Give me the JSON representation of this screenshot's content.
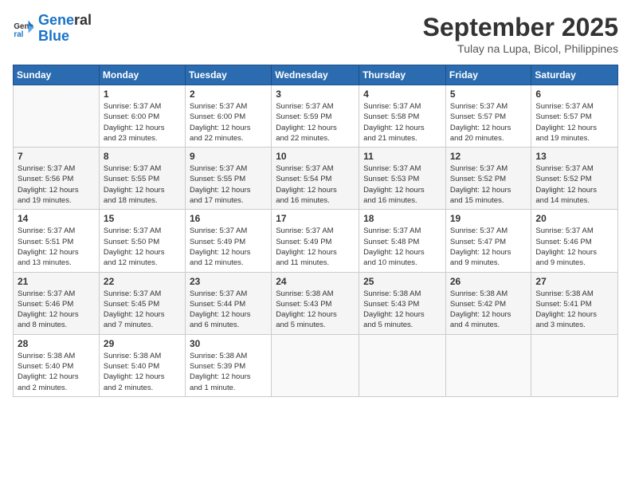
{
  "logo": {
    "line1": "General",
    "line2": "Blue"
  },
  "title": "September 2025",
  "location": "Tulay na Lupa, Bicol, Philippines",
  "days_header": [
    "Sunday",
    "Monday",
    "Tuesday",
    "Wednesday",
    "Thursday",
    "Friday",
    "Saturday"
  ],
  "weeks": [
    [
      {
        "day": "",
        "info": ""
      },
      {
        "day": "1",
        "info": "Sunrise: 5:37 AM\nSunset: 6:00 PM\nDaylight: 12 hours\nand 23 minutes."
      },
      {
        "day": "2",
        "info": "Sunrise: 5:37 AM\nSunset: 6:00 PM\nDaylight: 12 hours\nand 22 minutes."
      },
      {
        "day": "3",
        "info": "Sunrise: 5:37 AM\nSunset: 5:59 PM\nDaylight: 12 hours\nand 22 minutes."
      },
      {
        "day": "4",
        "info": "Sunrise: 5:37 AM\nSunset: 5:58 PM\nDaylight: 12 hours\nand 21 minutes."
      },
      {
        "day": "5",
        "info": "Sunrise: 5:37 AM\nSunset: 5:57 PM\nDaylight: 12 hours\nand 20 minutes."
      },
      {
        "day": "6",
        "info": "Sunrise: 5:37 AM\nSunset: 5:57 PM\nDaylight: 12 hours\nand 19 minutes."
      }
    ],
    [
      {
        "day": "7",
        "info": "Sunrise: 5:37 AM\nSunset: 5:56 PM\nDaylight: 12 hours\nand 19 minutes."
      },
      {
        "day": "8",
        "info": "Sunrise: 5:37 AM\nSunset: 5:55 PM\nDaylight: 12 hours\nand 18 minutes."
      },
      {
        "day": "9",
        "info": "Sunrise: 5:37 AM\nSunset: 5:55 PM\nDaylight: 12 hours\nand 17 minutes."
      },
      {
        "day": "10",
        "info": "Sunrise: 5:37 AM\nSunset: 5:54 PM\nDaylight: 12 hours\nand 16 minutes."
      },
      {
        "day": "11",
        "info": "Sunrise: 5:37 AM\nSunset: 5:53 PM\nDaylight: 12 hours\nand 16 minutes."
      },
      {
        "day": "12",
        "info": "Sunrise: 5:37 AM\nSunset: 5:52 PM\nDaylight: 12 hours\nand 15 minutes."
      },
      {
        "day": "13",
        "info": "Sunrise: 5:37 AM\nSunset: 5:52 PM\nDaylight: 12 hours\nand 14 minutes."
      }
    ],
    [
      {
        "day": "14",
        "info": "Sunrise: 5:37 AM\nSunset: 5:51 PM\nDaylight: 12 hours\nand 13 minutes."
      },
      {
        "day": "15",
        "info": "Sunrise: 5:37 AM\nSunset: 5:50 PM\nDaylight: 12 hours\nand 12 minutes."
      },
      {
        "day": "16",
        "info": "Sunrise: 5:37 AM\nSunset: 5:49 PM\nDaylight: 12 hours\nand 12 minutes."
      },
      {
        "day": "17",
        "info": "Sunrise: 5:37 AM\nSunset: 5:49 PM\nDaylight: 12 hours\nand 11 minutes."
      },
      {
        "day": "18",
        "info": "Sunrise: 5:37 AM\nSunset: 5:48 PM\nDaylight: 12 hours\nand 10 minutes."
      },
      {
        "day": "19",
        "info": "Sunrise: 5:37 AM\nSunset: 5:47 PM\nDaylight: 12 hours\nand 9 minutes."
      },
      {
        "day": "20",
        "info": "Sunrise: 5:37 AM\nSunset: 5:46 PM\nDaylight: 12 hours\nand 9 minutes."
      }
    ],
    [
      {
        "day": "21",
        "info": "Sunrise: 5:37 AM\nSunset: 5:46 PM\nDaylight: 12 hours\nand 8 minutes."
      },
      {
        "day": "22",
        "info": "Sunrise: 5:37 AM\nSunset: 5:45 PM\nDaylight: 12 hours\nand 7 minutes."
      },
      {
        "day": "23",
        "info": "Sunrise: 5:37 AM\nSunset: 5:44 PM\nDaylight: 12 hours\nand 6 minutes."
      },
      {
        "day": "24",
        "info": "Sunrise: 5:38 AM\nSunset: 5:43 PM\nDaylight: 12 hours\nand 5 minutes."
      },
      {
        "day": "25",
        "info": "Sunrise: 5:38 AM\nSunset: 5:43 PM\nDaylight: 12 hours\nand 5 minutes."
      },
      {
        "day": "26",
        "info": "Sunrise: 5:38 AM\nSunset: 5:42 PM\nDaylight: 12 hours\nand 4 minutes."
      },
      {
        "day": "27",
        "info": "Sunrise: 5:38 AM\nSunset: 5:41 PM\nDaylight: 12 hours\nand 3 minutes."
      }
    ],
    [
      {
        "day": "28",
        "info": "Sunrise: 5:38 AM\nSunset: 5:40 PM\nDaylight: 12 hours\nand 2 minutes."
      },
      {
        "day": "29",
        "info": "Sunrise: 5:38 AM\nSunset: 5:40 PM\nDaylight: 12 hours\nand 2 minutes."
      },
      {
        "day": "30",
        "info": "Sunrise: 5:38 AM\nSunset: 5:39 PM\nDaylight: 12 hours\nand 1 minute."
      },
      {
        "day": "",
        "info": ""
      },
      {
        "day": "",
        "info": ""
      },
      {
        "day": "",
        "info": ""
      },
      {
        "day": "",
        "info": ""
      }
    ]
  ]
}
